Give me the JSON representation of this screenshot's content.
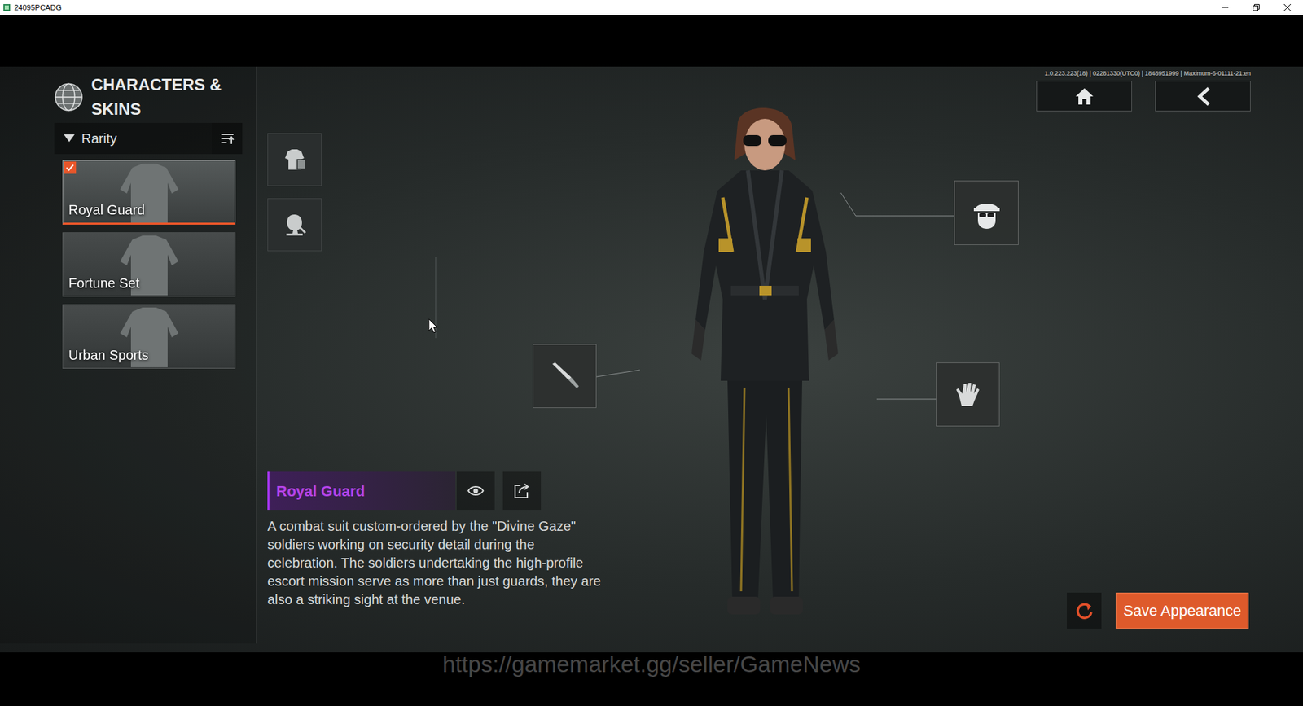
{
  "window": {
    "title": "24095PCADG"
  },
  "version": "1.0.223.223(18) | 02281330(UTC0) | 1848951999 | Maximum-6-01111-21:en",
  "header": {
    "title": "CHARACTERS & SKINS"
  },
  "filter": {
    "label": "Rarity",
    "expanded": true
  },
  "skins": [
    {
      "name": "Royal Guard",
      "selected": true,
      "checked": true
    },
    {
      "name": "Fortune Set",
      "selected": false,
      "checked": false
    },
    {
      "name": "Urban Sports",
      "selected": false,
      "checked": false
    }
  ],
  "detail": {
    "name": "Royal Guard",
    "description": "A combat suit custom-ordered by the \"Divine Gaze\" soldiers working on security detail during the celebration. The soldiers undertaking the high-profile escort mission serve as more than just guards, they are also a striking sight at the venue."
  },
  "buttons": {
    "save": "Save Appearance"
  },
  "watermark": "https://gamemarket.gg/seller/GameNews"
}
